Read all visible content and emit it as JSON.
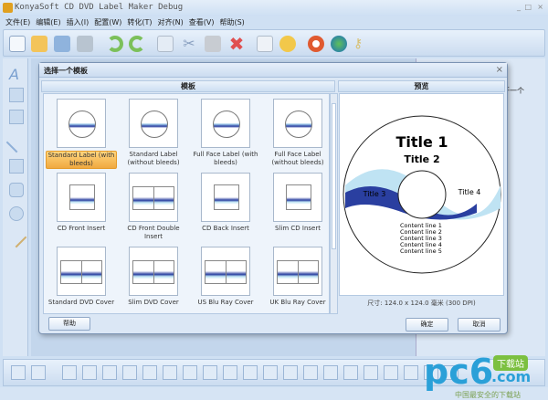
{
  "app": {
    "title": "KonyaSoft CD DVD Label Maker Debug"
  },
  "menu": [
    "文件(E)",
    "编辑(E)",
    "插入(I)",
    "配置(W)",
    "转化(T)",
    "对齐(N)",
    "查看(V)",
    "帮助(S)"
  ],
  "right_panel": {
    "text": "打开一个"
  },
  "dialog": {
    "title": "选择一个模板",
    "templates_header": "模板",
    "preview_header": "预览",
    "templates": [
      {
        "label": "Standard Label (with bleeds)",
        "selected": true,
        "kind": "disc"
      },
      {
        "label": "Standard Label (without bleeds)",
        "kind": "disc"
      },
      {
        "label": "Full Face Label (with bleeds)",
        "kind": "disc"
      },
      {
        "label": "Full Face Label (without bleeds)",
        "kind": "disc"
      },
      {
        "label": "CD Front Insert",
        "kind": "insert"
      },
      {
        "label": "CD Front Double Insert",
        "kind": "double"
      },
      {
        "label": "CD Back Insert",
        "kind": "insert"
      },
      {
        "label": "Slim CD Insert",
        "kind": "insert"
      },
      {
        "label": "Standard DVD Cover",
        "kind": "double"
      },
      {
        "label": "Slim DVD Cover",
        "kind": "double"
      },
      {
        "label": "US Blu Ray Cover",
        "kind": "double"
      },
      {
        "label": "UK Blu Ray Cover",
        "kind": "double"
      }
    ],
    "preview": {
      "title1": "Title 1",
      "title2": "Title 2",
      "title3": "Title 3",
      "title4": "Title 4",
      "content": [
        "Content line 1",
        "Content line 2",
        "Content line 3",
        "Content line 4",
        "Content line 5"
      ]
    },
    "size_text": "尺寸: 124.0 x 124.0 毫米 (300 DPI)",
    "help": "帮助",
    "ok": "确定",
    "cancel": "取消"
  },
  "watermark": {
    "brand": "pc6",
    "tag": "下载站",
    "domain": ".com",
    "slogan": "中国最安全的下载站"
  }
}
